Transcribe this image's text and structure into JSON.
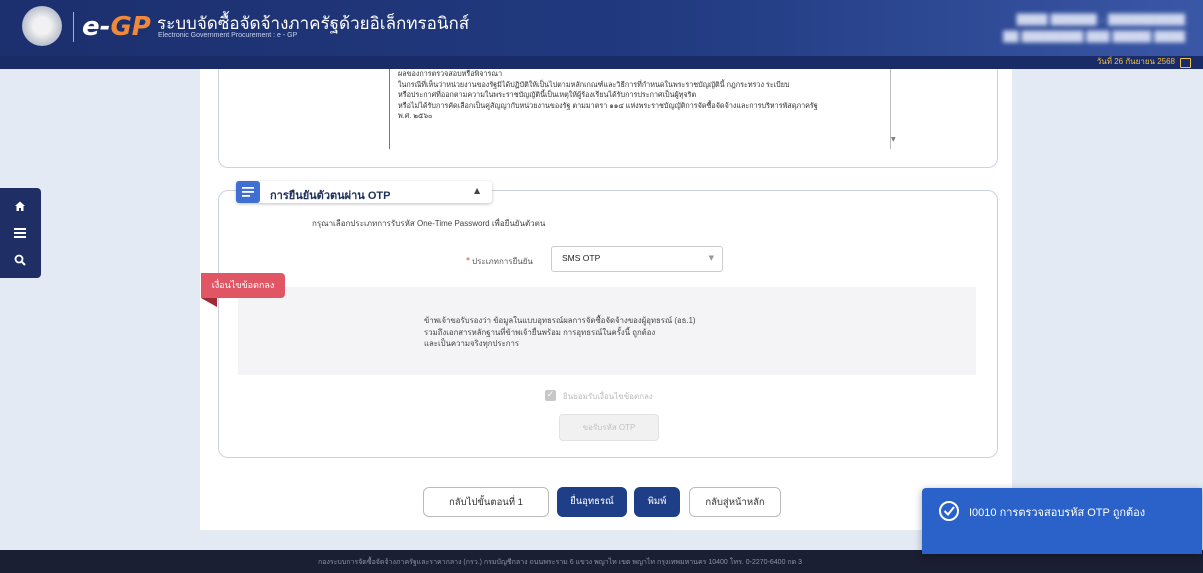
{
  "header": {
    "title": "ระบบจัดซื้อจัดจ้างภาครัฐด้วยอิเล็กทรอนิกส์",
    "subtitle": "Electronic Government Procurement : e - GP",
    "logo_e": "e-",
    "logo_gp": "GP"
  },
  "topbar": {
    "date": "วันที่ 26 กันยายน 2568"
  },
  "sidebar": {
    "icons": [
      "home-icon",
      "menu-icon",
      "search-icon"
    ]
  },
  "terms": {
    "lines": [
      "ผลของการตรวจสอบหรือพิจารณา",
      "ในกรณีที่เห็นว่าหน่วยงานของรัฐมิได้ปฏิบัติให้เป็นไปตามหลักเกณฑ์และวิธีการที่กำหนดในพระราชบัญญัตินี้ กฎกระทรวง ระเบียบ",
      "หรือประกาศที่ออกตามความในพระราชบัญญัตินี้เป็นเหตุให้ผู้ร้องเรียนได้รับการประกาศเป็นผู้ทุจริต",
      "หรือไม่ได้รับการคัดเลือกเป็นคู่สัญญากับหน่วยงานของรัฐ ตามมาตรา ๑๑๔ แห่งพระราชบัญญัติการจัดซื้อจัดจ้างและการบริหารพัสดุภาครัฐ",
      "พ.ศ. ๒๕๖๐"
    ]
  },
  "otp_section": {
    "title": "การยืนยันตัวตนผ่าน OTP",
    "description": "กรุณาเลือกประเภทการรับรหัส One-Time Password เพื่อยืนยันตัวตน",
    "method_label": "ประเภทการยืนยัน",
    "method_value": "SMS OTP",
    "ribbon": "เงื่อนไขข้อตกลง",
    "agreement_lines": [
      "ข้าพเจ้าขอรับรองว่า ข้อมูลในแบบอุทธรณ์ผลการจัดซื้อจัดจ้างของผู้อุทธรณ์ (อธ.1)",
      "รวมถึงเอกสารหลักฐานที่ข้าพเจ้ายื่นพร้อม การอุทธรณ์ในครั้งนี้ ถูกต้อง",
      "และเป็นความจริงทุกประการ"
    ],
    "accept_label": "ยินยอมรับเงื่อนไขข้อตกลง",
    "request_otp_label": "ขอรับรหัส OTP"
  },
  "actions": {
    "back": "กลับไปขั้นตอนที่ 1",
    "submit": "ยื่นอุทธรณ์",
    "print": "พิมพ์",
    "home": "กลับสู่หน้าหลัก"
  },
  "footer": {
    "text": "กองระบบการจัดซื้อจัดจ้างภาครัฐและราคากลาง (กรว.) กรมบัญชีกลาง ถนนพระราม 6 แขวง พญาไท เขต พญาไท กรุงเทพมหานคร 10400 โทร. 0-2270-6400 กด 3"
  },
  "toast": {
    "message": "I0010 การตรวจสอบรหัส OTP ถูกต้อง"
  },
  "colors": {
    "header": "#213a80",
    "accent_orange": "#f08a3a",
    "primary_button": "#1e3f88",
    "ribbon": "#e05664",
    "toast": "#2a62c9"
  }
}
